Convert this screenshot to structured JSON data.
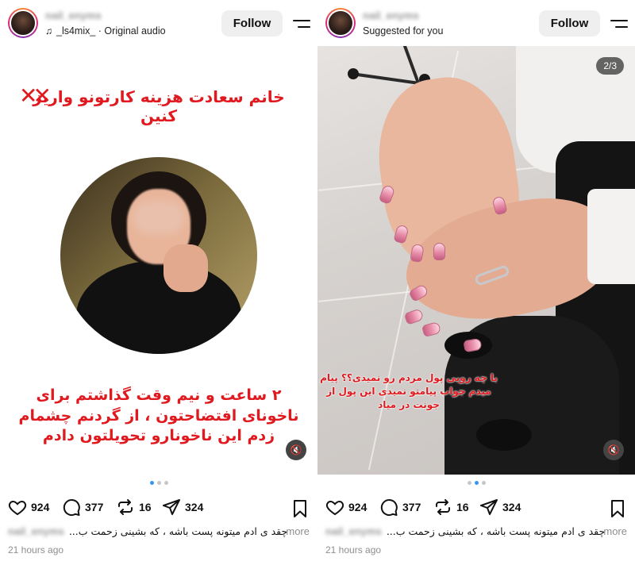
{
  "posts": [
    {
      "username": "nail_enyms",
      "subline": "_ls4mix_ · Original audio",
      "follow_label": "Follow",
      "title_text": "خانم سعادت هزینه کارتونو واریز کنین",
      "title_marks": "✕✕",
      "body_text": "۲ ساعت و نیم وقت گذاشتم برای ناخونای افتضاحتون ، از گردنم چشمام زدم این ناخونارو تحویلتون دادم",
      "likes": "924",
      "comments": "377",
      "reposts": "16",
      "shares": "324",
      "caption_user": "nail_enyms",
      "caption_text": "چقد ی ادم میتونه پست باشه ، که بشینی زحمت ب...",
      "more_label": "more",
      "time": "21 hours ago",
      "carousel_active": 0
    },
    {
      "username": "nail_enyms",
      "subline": "Suggested for you",
      "follow_label": "Follow",
      "counter": "2/3",
      "photo_caption": "با چه رویی پول مردم رو نمیدی؟؟ پیام میدم جواب پیامتو نمیدی این پول از جونت در میاد",
      "likes": "924",
      "comments": "377",
      "reposts": "16",
      "shares": "324",
      "caption_user": "nail_enyms",
      "caption_text": "چقد ی ادم میتونه پست باشه ، که بشینی زحمت ب...",
      "more_label": "more",
      "time": "21 hours ago",
      "carousel_active": 1
    }
  ],
  "icons": {
    "music": "music-note-icon",
    "menu": "menu-icon",
    "like": "heart-icon",
    "comment": "comment-icon",
    "repost": "repost-icon",
    "share": "share-icon",
    "save": "bookmark-icon",
    "mute": "muted-speaker-icon"
  },
  "colors": {
    "accent_red": "#e0191f",
    "carousel_active": "#3897f0",
    "follow_bg": "#efefef",
    "muted_text": "#8e8e8e"
  }
}
